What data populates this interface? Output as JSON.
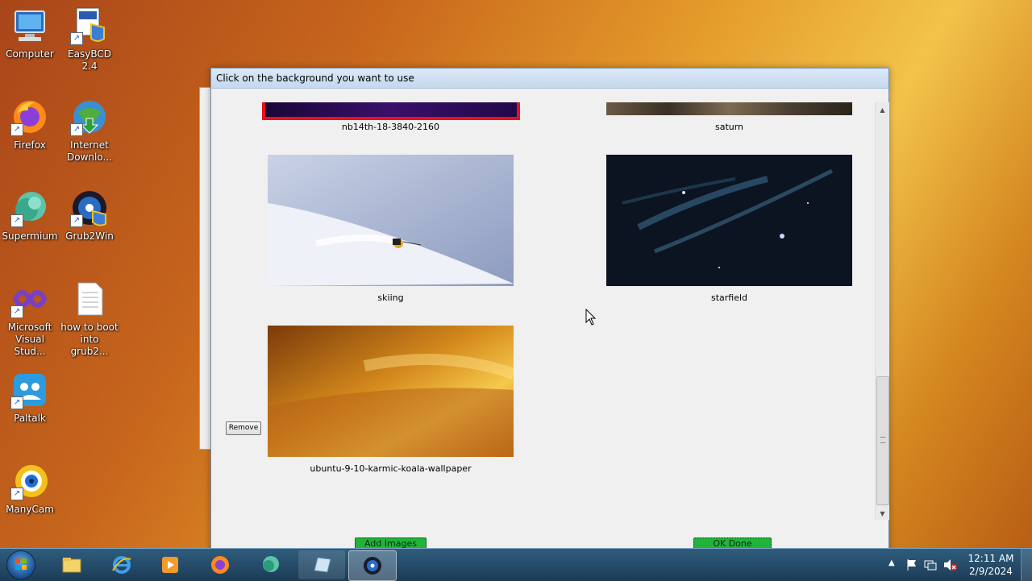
{
  "desktop": {
    "icons": [
      {
        "label": "Computer",
        "icon": "computer-icon"
      },
      {
        "label": "EasyBCD 2.4",
        "icon": "easybcd-icon"
      },
      {
        "label": "Firefox",
        "icon": "firefox-icon"
      },
      {
        "label": "Internet Downlo...",
        "icon": "internet-download-manager-icon"
      },
      {
        "label": "Supermium",
        "icon": "supermium-icon"
      },
      {
        "label": "Grub2Win",
        "icon": "grub2win-icon"
      },
      {
        "label": "Microsoft Visual Stud...",
        "icon": "visual-studio-icon"
      },
      {
        "label": "how to boot into grub2...",
        "icon": "text-file-icon"
      },
      {
        "label": "Paltalk",
        "icon": "paltalk-icon"
      },
      {
        "label": "ManyCam",
        "icon": "manycam-icon"
      }
    ]
  },
  "dialog": {
    "title": "Click on the background you want to use",
    "backgrounds": [
      {
        "name": "nb14th-18-3840-2160",
        "selected": true
      },
      {
        "name": "saturn",
        "selected": false
      },
      {
        "name": "skiing",
        "selected": false
      },
      {
        "name": "starfield",
        "selected": false
      },
      {
        "name": "ubuntu-9-10-karmic-koala-wallpaper",
        "selected": false
      }
    ],
    "remove_label": "Remove",
    "add_images_label": "Add Images",
    "ok_done_label": "OK Done"
  },
  "taskbar": {
    "items": [
      "windows-explorer-icon",
      "internet-explorer-icon",
      "media-player-icon",
      "firefox-icon",
      "supermium-icon",
      "notepad-icon",
      "grub2win-icon"
    ],
    "active_item": "grub2win-icon",
    "clock_time": "12:11 AM",
    "clock_date": "2/9/2024"
  },
  "colors": {
    "selection_border": "#e8101a",
    "green_button": "#22b33b",
    "taskbar": "#1c3b55"
  }
}
